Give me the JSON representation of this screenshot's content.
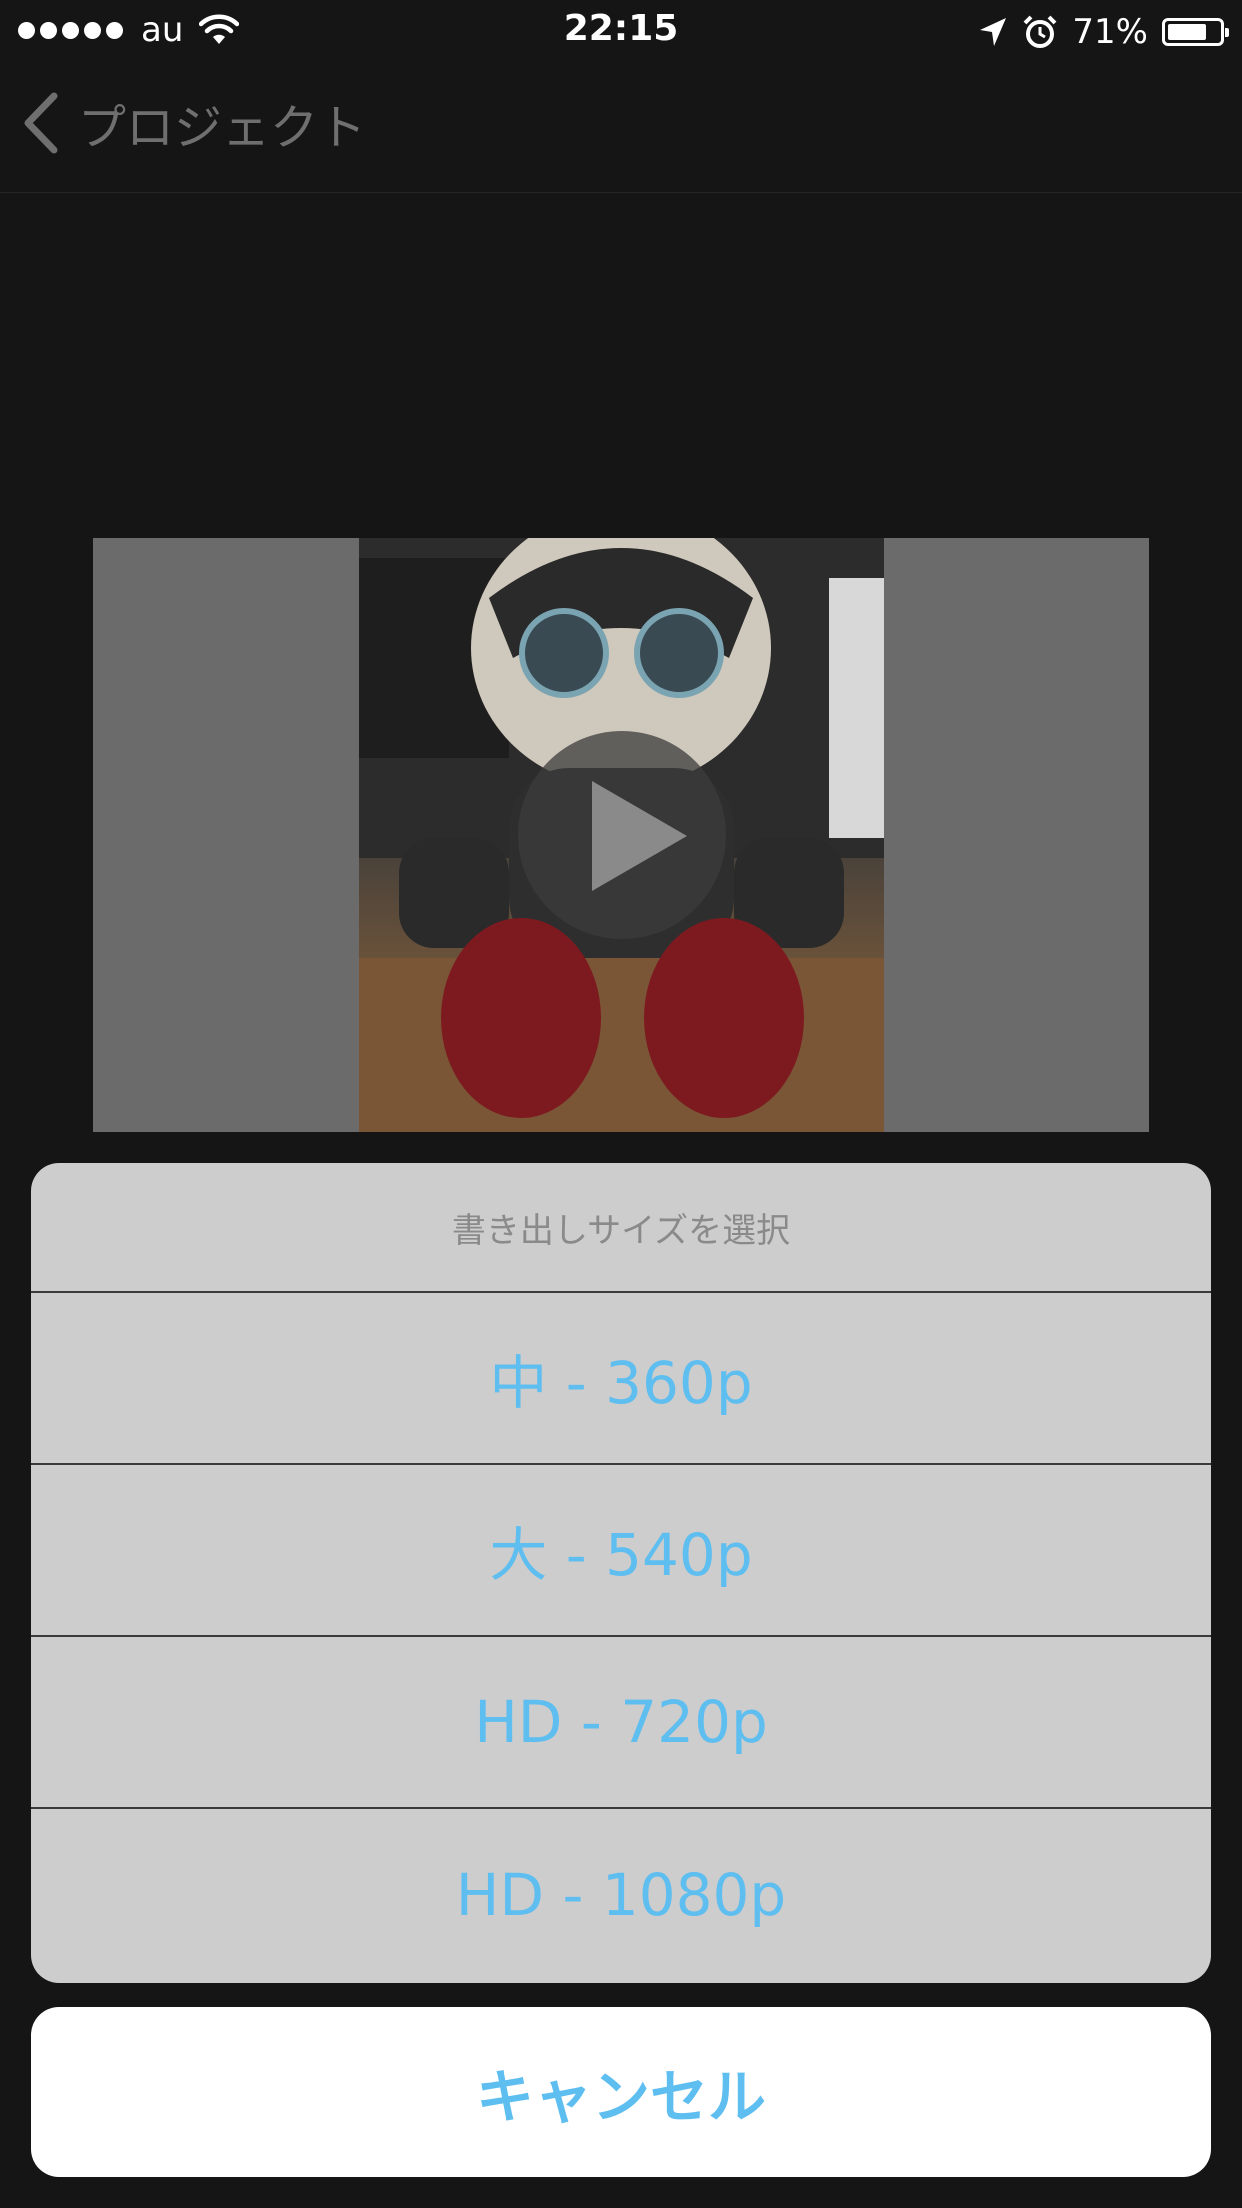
{
  "status_bar": {
    "carrier": "au",
    "time": "22:15",
    "battery_percent": "71%",
    "battery_level": 0.71,
    "icons": [
      "signal-dots-icon",
      "wifi-icon",
      "location-arrow-icon",
      "alarm-clock-icon",
      "battery-icon"
    ]
  },
  "nav": {
    "back_label": "プロジェクト"
  },
  "preview": {
    "icon": "play-icon"
  },
  "action_sheet": {
    "title": "書き出しサイズを選択",
    "options": [
      "中 - 360p",
      "大 - 540p",
      "HD - 720p",
      "HD - 1080p"
    ],
    "cancel_label": "キャンセル",
    "accent_color": "#5fbef0"
  }
}
